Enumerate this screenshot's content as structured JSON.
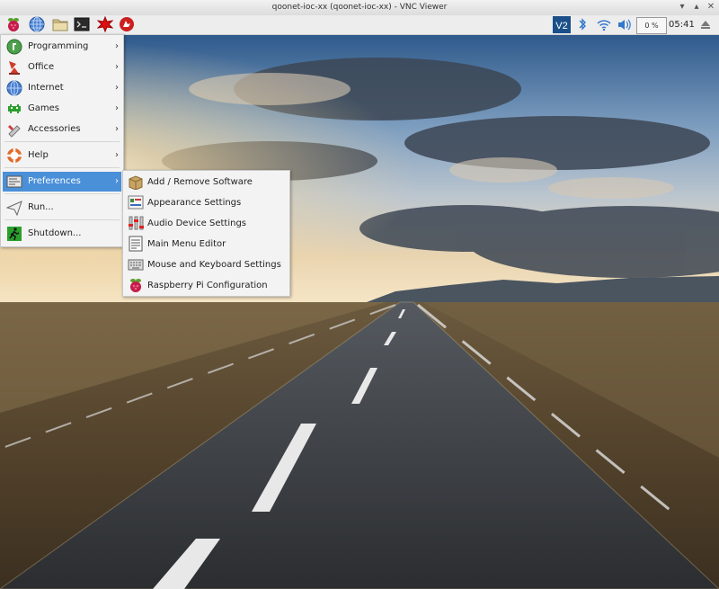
{
  "window": {
    "title": "qoonet-ioc-xx (qoonet-ioc-xx) - VNC Viewer"
  },
  "panel": {
    "launchers": [
      "raspberry-menu-icon",
      "web-browser-icon",
      "file-manager-icon",
      "terminal-icon",
      "mathematica-icon",
      "wolfram-icon"
    ],
    "cpu_usage": "0 %",
    "clock": "05:41",
    "tray": [
      "vnc-icon",
      "bluetooth-icon",
      "wifi-icon",
      "volume-icon",
      "eject-icon"
    ]
  },
  "main_menu": {
    "items": [
      {
        "label": "Programming"
      },
      {
        "label": "Office"
      },
      {
        "label": "Internet"
      },
      {
        "label": "Games"
      },
      {
        "label": "Accessories"
      },
      {
        "label": "Help"
      },
      {
        "label": "Preferences"
      },
      {
        "label": "Run..."
      },
      {
        "label": "Shutdown..."
      }
    ],
    "arrow": "›",
    "selected": "Preferences"
  },
  "preferences_menu": {
    "items": [
      {
        "label": "Add / Remove Software"
      },
      {
        "label": "Appearance Settings"
      },
      {
        "label": "Audio Device Settings"
      },
      {
        "label": "Main Menu Editor"
      },
      {
        "label": "Mouse and Keyboard Settings"
      },
      {
        "label": "Raspberry Pi Configuration"
      }
    ]
  },
  "colors": {
    "menu_highlight": "#4a90d9",
    "panel_bg": "#ededed",
    "vnc_badge": "#1a4f8a"
  }
}
